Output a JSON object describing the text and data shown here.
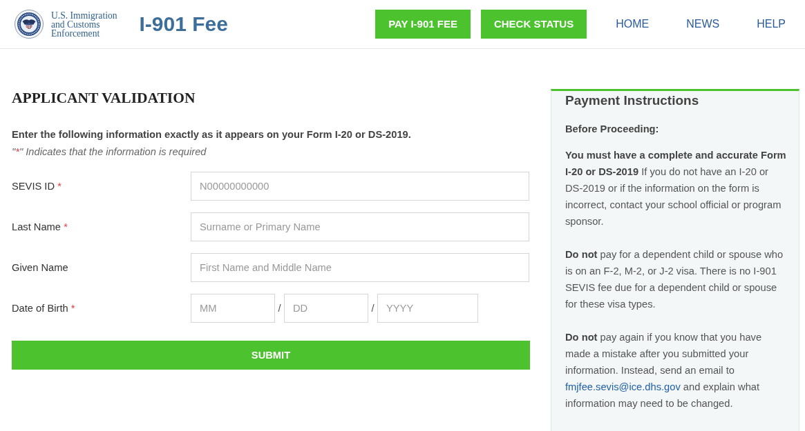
{
  "header": {
    "agency_lines": [
      "U.S. Immigration",
      "and Customs",
      "Enforcement"
    ],
    "site_title": "I-901 Fee",
    "nav": [
      {
        "kind": "button",
        "label": "PAY I-901 FEE"
      },
      {
        "kind": "button",
        "label": "CHECK STATUS"
      },
      {
        "kind": "link",
        "label": "HOME"
      },
      {
        "kind": "link",
        "label": "NEWS"
      },
      {
        "kind": "link",
        "label": "HELP"
      }
    ]
  },
  "form": {
    "title": "APPLICANT VALIDATION",
    "intro": "Enter the following information exactly as it appears on your Form I-20 or DS-2019.",
    "required_note": {
      "before": "\"",
      "marker": "*",
      "after": "\" Indicates that the information is required"
    },
    "fields": [
      {
        "kind": "text",
        "label": "SEVIS ID",
        "required_mark": "*",
        "placeholder": "N00000000000"
      },
      {
        "kind": "text",
        "label": "Last Name",
        "required_mark": "*",
        "placeholder": "Surname or Primary Name"
      },
      {
        "kind": "text",
        "label": "Given Name",
        "placeholder": "First Name and Middle Name"
      },
      {
        "kind": "date",
        "label": "Date of Birth",
        "required_mark": "*",
        "parts": [
          {
            "kind": "input",
            "placeholder": "MM"
          },
          {
            "kind": "separator",
            "text": "/"
          },
          {
            "kind": "input",
            "placeholder": "DD"
          },
          {
            "kind": "separator",
            "text": "/"
          },
          {
            "kind": "input",
            "placeholder": "YYYY"
          }
        ]
      }
    ],
    "submit": "SUBMIT"
  },
  "sidebar": {
    "title": "Payment Instructions",
    "subtitle": "Before Proceeding:",
    "paragraphs": [
      {
        "text": "**You must have a complete and accurate Form I-20 or DS-2019** If you do not have an I-20 or DS-2019 or if the information on the form is incorrect, contact your school official or program sponsor."
      },
      {
        "text": "**Do not** pay for a dependent child or spouse who is on an F-2, M-2, or J-2 visa. There is no I-901 SEVIS fee due for a dependent child or spouse for these visa types."
      },
      {
        "text": "**Do not** pay again if you know that you have made a mistake after you submitted your information. Instead, send an email to",
        "link": "fmjfee.sevis@ice.dhs.gov",
        "after": "and explain what information may need to be changed."
      }
    ]
  }
}
